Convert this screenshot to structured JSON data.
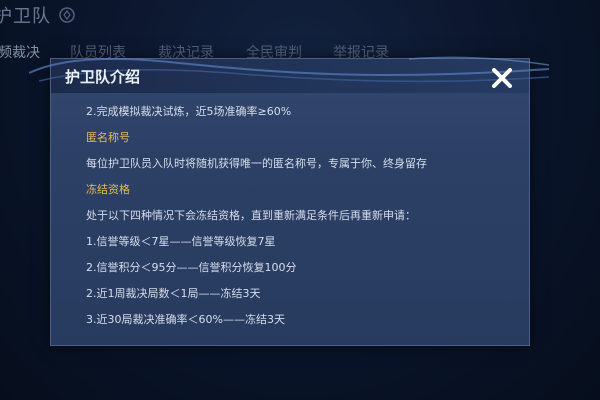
{
  "background": {
    "page_title": "护卫队",
    "tabs": [
      {
        "label": "频裁决",
        "active": true
      },
      {
        "label": "队员列表",
        "active": false
      },
      {
        "label": "裁决记录",
        "active": false
      },
      {
        "label": "全民审判",
        "active": false
      },
      {
        "label": "举报记录",
        "active": false
      }
    ]
  },
  "modal": {
    "title": "护卫队介绍",
    "lines": [
      {
        "text": "2.完成模拟裁决试炼，近5场准确率≥60%",
        "type": "text"
      },
      {
        "text": "匿名称号",
        "type": "heading"
      },
      {
        "text": "每位护卫队员入队时将随机获得唯一的匿名称号，专属于你、终身留存",
        "type": "text"
      },
      {
        "text": "冻结资格",
        "type": "heading"
      },
      {
        "text": "处于以下四种情况下会冻结资格，直到重新满足条件后再重新申请：",
        "type": "text"
      },
      {
        "text": "1.信誉等级＜7星——信誉等级恢复7星",
        "type": "text"
      },
      {
        "text": "2.信誉积分＜95分——信誉积分恢复100分",
        "type": "text"
      },
      {
        "text": "2.近1周裁决局数＜1局——冻结3天",
        "type": "text"
      },
      {
        "text": "3.近30局裁决准确率＜60%——冻结3天",
        "type": "text"
      }
    ],
    "close_icon": "close-x-icon"
  },
  "colors": {
    "heading": "#e8b956",
    "body_text": "#d6deec",
    "modal_bg": "#2c4066",
    "page_bg": "#0d1a33"
  }
}
